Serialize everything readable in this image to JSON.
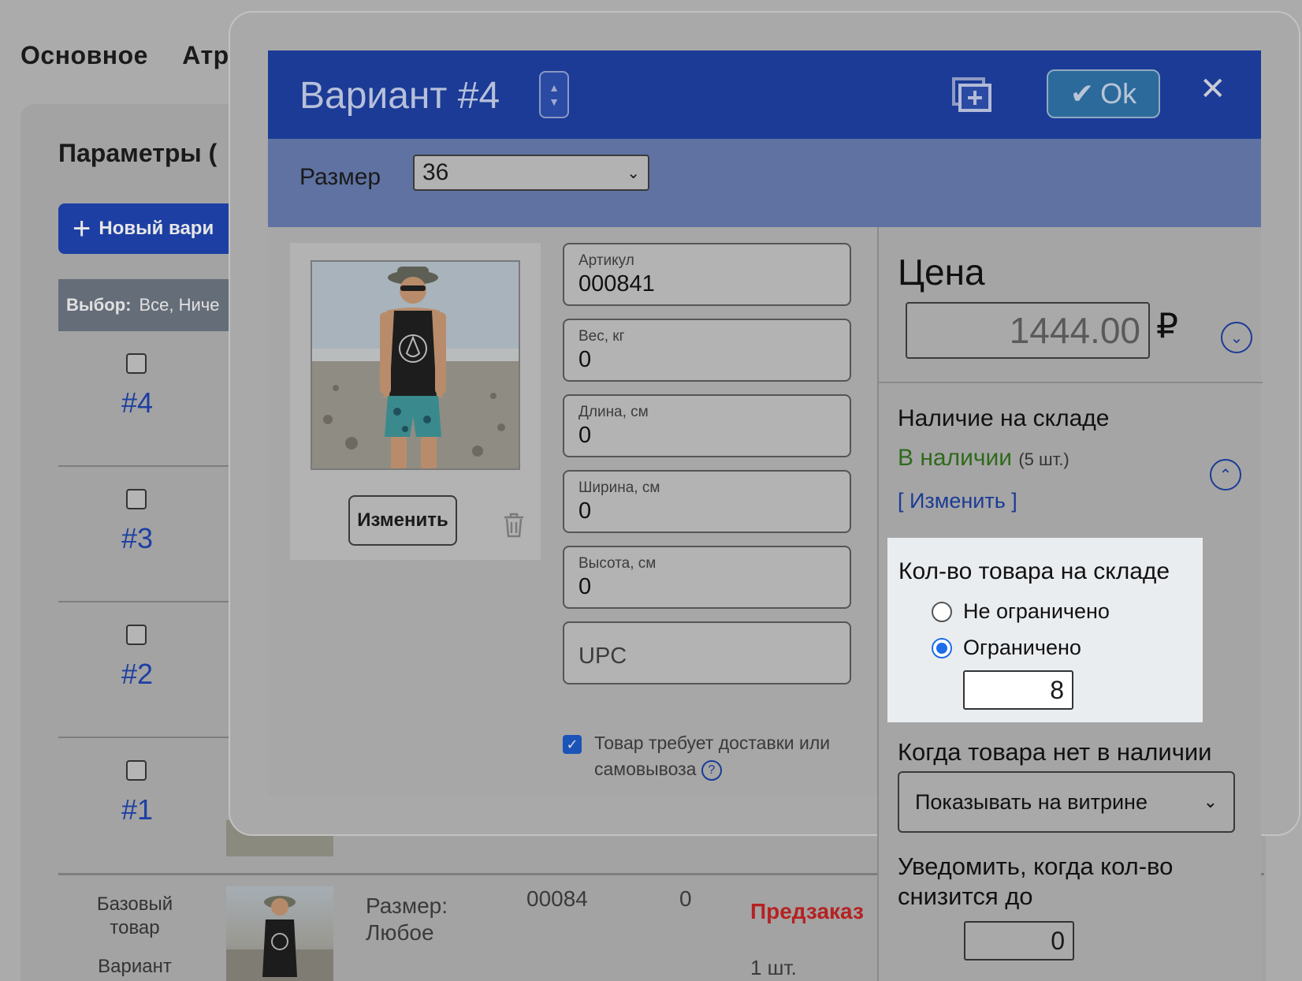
{
  "background": {
    "tabs": [
      "Основное",
      "Атр"
    ],
    "panel_title": "Параметры (",
    "new_variant_label": "Новый вари",
    "filter_label": "Выбор:",
    "filter_value": "Все, Ниче",
    "rows": [
      {
        "number": "#4"
      },
      {
        "number": "#3"
      },
      {
        "number": "#2"
      },
      {
        "number": "#1"
      }
    ],
    "base_row": {
      "label_line1": "Базовый",
      "label_line2": "товар",
      "variant_label": "Вариант",
      "size_line1": "Размер:",
      "size_line2": "Любое",
      "sku": "00084",
      "weight": "0",
      "status": "Предзаказ",
      "qty": "1 шт."
    }
  },
  "dialog": {
    "title": "Вариант #4",
    "ok_label": "Ok",
    "size": {
      "label": "Размер",
      "value": "36"
    },
    "change_image_label": "Изменить",
    "fields": [
      {
        "label": "Артикул",
        "value": "000841"
      },
      {
        "label": "Вес, кг",
        "value": "0"
      },
      {
        "label": "Длина, см",
        "value": "0"
      },
      {
        "label": "Ширина, см",
        "value": "0"
      },
      {
        "label": "Высота, см",
        "value": "0"
      }
    ],
    "upc_placeholder": "UPC",
    "shipping_checkbox": {
      "checked": true,
      "label": "Товар требует доставки или самовывоза"
    }
  },
  "pricing": {
    "title": "Цена",
    "value": "1444.00",
    "currency": "₽"
  },
  "stock": {
    "title": "Наличие на складе",
    "status": "В наличии",
    "status_count": "(5 шт.)",
    "edit_link": "[ Изменить ]",
    "status_color": "#2e6a1c"
  },
  "quantity": {
    "title": "Кол-во товара на складе",
    "options": [
      {
        "label": "Не ограничено",
        "selected": false
      },
      {
        "label": "Ограничено",
        "selected": true
      }
    ],
    "value": "8"
  },
  "out_of_stock": {
    "title": "Когда товара нет в наличии",
    "selected": "Показывать на витрине"
  },
  "notify": {
    "title": "Уведомить, когда кол-во снизится до",
    "value": "0"
  },
  "colors": {
    "header_blue": "#1b3b96",
    "accent_radio": "#1e6ee8",
    "preorder_red": "#b52222"
  }
}
